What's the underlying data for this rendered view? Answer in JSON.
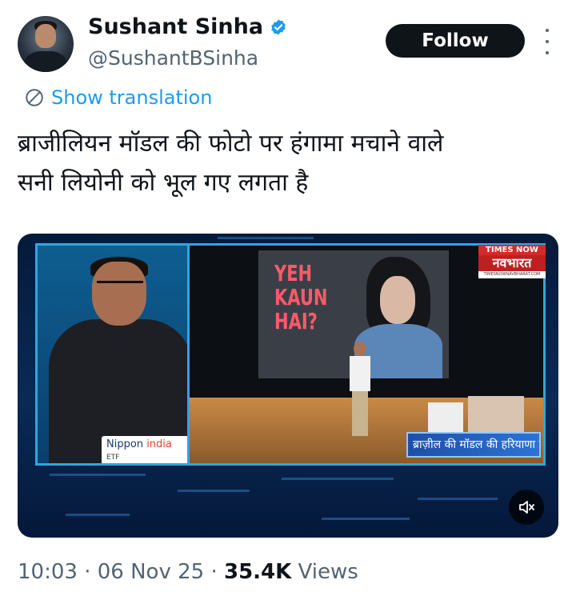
{
  "author": {
    "name": "Sushant Sinha",
    "handle": "@SushantBSinha",
    "verified_color": "#1d9bf0"
  },
  "follow_label": "Follow",
  "translate_label": "Show translation",
  "tweet_text_line1": "ब्राजीलियन मॉडल की फोटो पर हंगामा मचाने वाले",
  "tweet_text_line2": "सनी लियोनी को भूल गए लगता है",
  "video": {
    "screen_text_line1": "YEH",
    "screen_text_line2": "KAUN",
    "screen_text_line3": "HAI?",
    "channel_logo_top": "TIMES NOW",
    "channel_logo_main": "नवभारत",
    "channel_logo_url": "TIMESNOWNAVBHARAT.COM",
    "sponsor_name": "Nippon",
    "sponsor_name_accent": "india",
    "sponsor_sub": "ETF",
    "ticker_text": "ब्राज़ील की मॉडल की हरियाणा में वोटिंग..",
    "mute_icon": "volume-muted-icon"
  },
  "meta": {
    "time": "10:03",
    "date": "06 Nov 25",
    "views_count": "35.4K",
    "views_label": "Views",
    "separator": "·"
  }
}
